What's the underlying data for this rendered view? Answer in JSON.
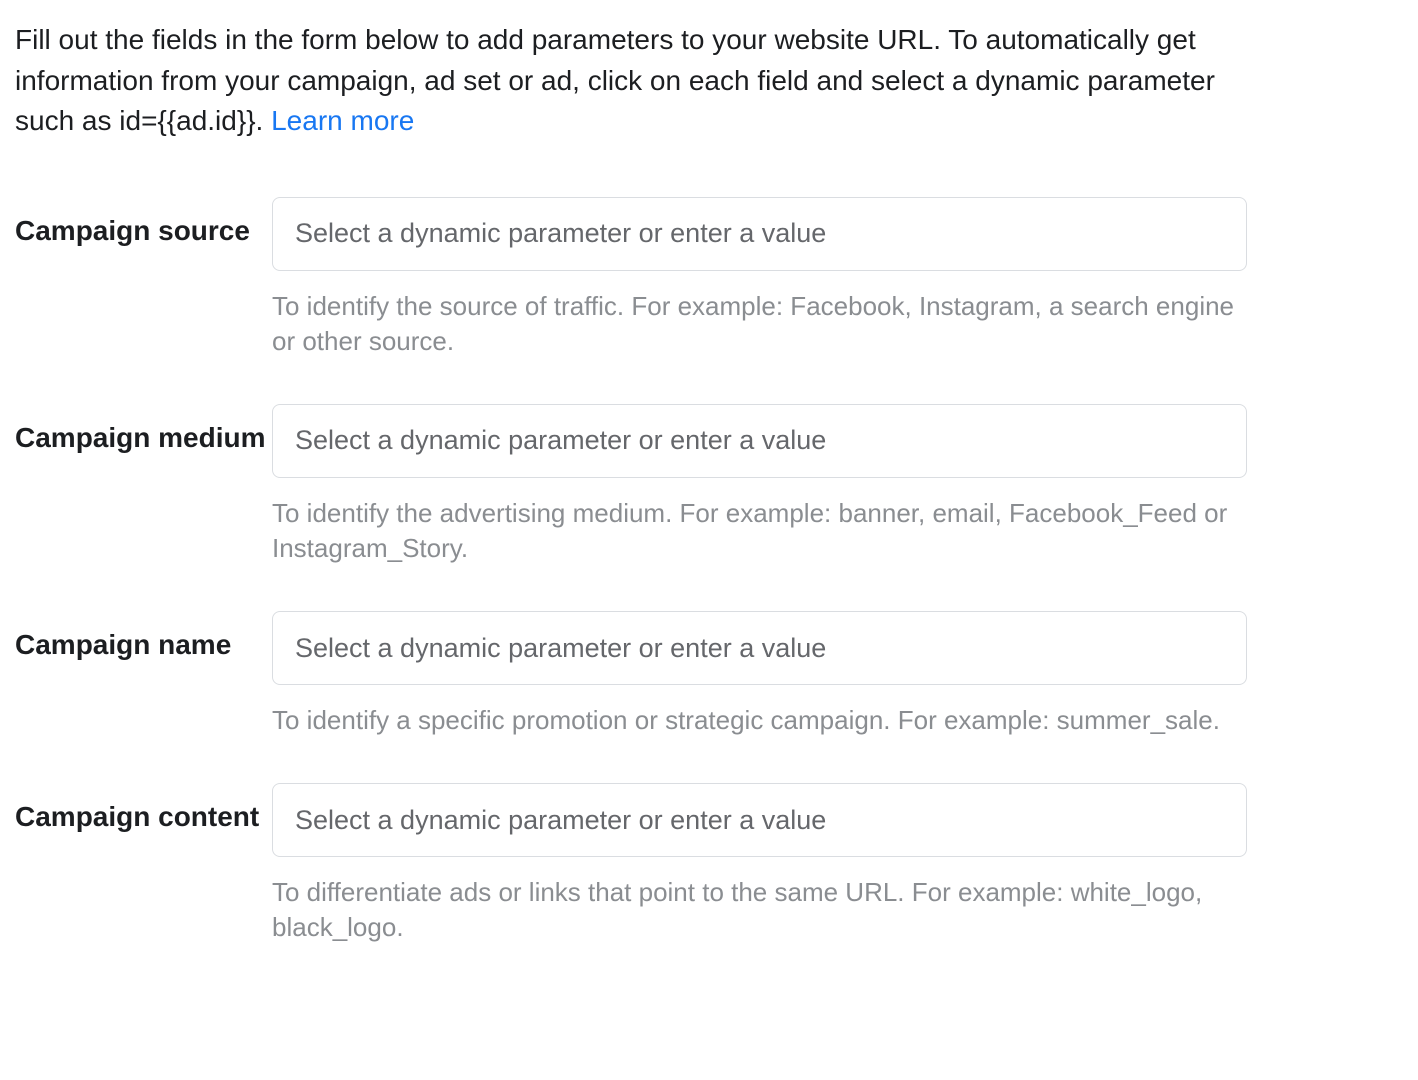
{
  "intro": {
    "text": "Fill out the fields in the form below to add parameters to your website URL. To automatically get information from your campaign, ad set or ad, click on each field and select a dynamic parameter such as id={{ad.id}}. ",
    "link_text": "Learn more"
  },
  "fields": {
    "source": {
      "label": "Campaign source",
      "placeholder": "Select a dynamic parameter or enter a value",
      "hint": "To identify the source of traffic. For example: Facebook, Instagram, a search engine or other source."
    },
    "medium": {
      "label": "Campaign medium",
      "placeholder": "Select a dynamic parameter or enter a value",
      "hint": "To identify the advertising medium. For example: banner, email, Facebook_Feed or Instagram_Story."
    },
    "name": {
      "label": "Campaign name",
      "placeholder": "Select a dynamic parameter or enter a value",
      "hint": "To identify a specific promotion or strategic campaign. For example: summer_sale."
    },
    "content": {
      "label": "Campaign content",
      "placeholder": "Select a dynamic parameter or enter a value",
      "hint": "To differentiate ads or links that point to the same URL. For example: white_logo, black_logo."
    }
  }
}
